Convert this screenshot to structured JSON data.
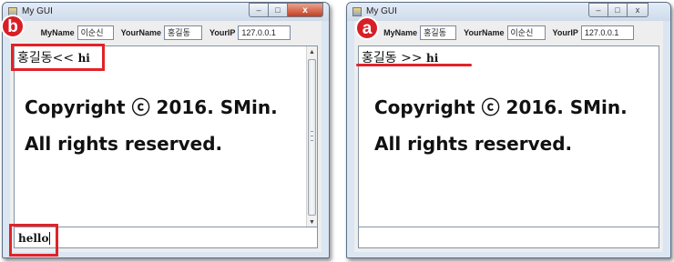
{
  "colors": {
    "annotation": "#e22228",
    "titlebar": "#dbe6f3",
    "close_button": "#c23e21"
  },
  "windows": [
    {
      "badge": "b",
      "title": "My GUI",
      "controls": {
        "min": "–",
        "max": "□",
        "close": "x"
      },
      "labels": {
        "myname": "MyName",
        "yourname": "YourName",
        "yourip": "YourIP"
      },
      "fields": {
        "myname": "이순신",
        "yourname": "홍길동",
        "yourip": "127.0.0.1"
      },
      "chat": {
        "sender": "홍길동<<",
        "message": "hi"
      },
      "input_value": "hello",
      "watermark": [
        "Copyright ⓒ 2016. SMin.",
        "All rights reserved."
      ]
    },
    {
      "badge": "a",
      "title": "My GUI",
      "controls": {
        "min": "–",
        "max": "□",
        "close": "x"
      },
      "labels": {
        "myname": "MyName",
        "yourname": "YourName",
        "yourip": "YourIP"
      },
      "fields": {
        "myname": "홍길동",
        "yourname": "이순신",
        "yourip": "127.0.0.1"
      },
      "chat": {
        "sender": "홍길동 >>",
        "message": "hi"
      },
      "input_value": "",
      "watermark": [
        "Copyright ⓒ 2016. SMin.",
        "All rights reserved."
      ]
    }
  ]
}
